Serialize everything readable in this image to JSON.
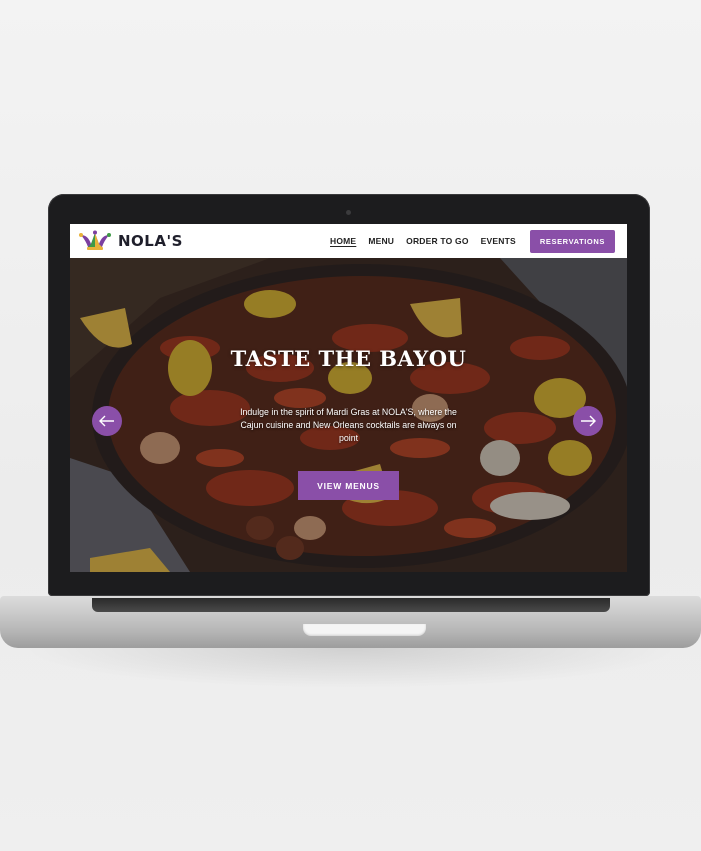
{
  "site": {
    "logo_text": "NOLA'S",
    "nav": [
      {
        "label": "HOME",
        "active": true
      },
      {
        "label": "MENU",
        "active": false
      },
      {
        "label": "ORDER TO GO",
        "active": false
      },
      {
        "label": "EVENTS",
        "active": false
      }
    ],
    "reservations_label": "RESERVATIONS"
  },
  "hero": {
    "title": "TASTE THE BAYOU",
    "subtitle": "Indulge in the spirit of Mardi Gras at NOLA'S, where the Cajun cuisine and New Orleans cocktails are always on point",
    "cta_label": "VIEW MENUS",
    "prev_icon": "arrow-left-icon",
    "next_icon": "arrow-right-icon"
  },
  "colors": {
    "accent": "#8a4fa8",
    "header_bg": "#ffffff",
    "logo_gold": "#e8b23a",
    "logo_green": "#3f9a47",
    "logo_purple": "#7b3fa0"
  }
}
